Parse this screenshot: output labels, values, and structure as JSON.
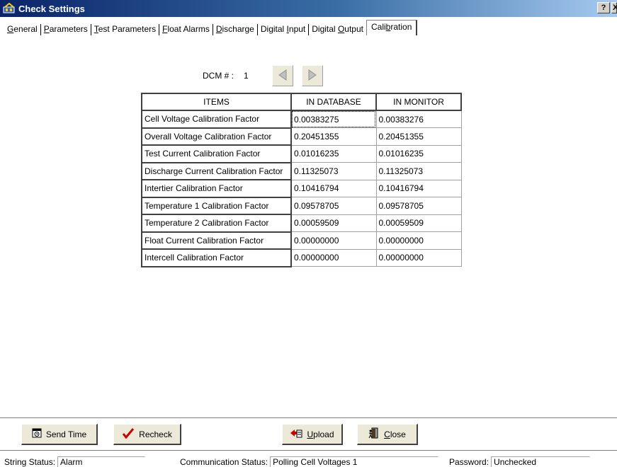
{
  "window": {
    "title": "Check Settings",
    "help_button": "?",
    "close_button": "X"
  },
  "tabs": [
    {
      "label": "General"
    },
    {
      "label": "Parameters"
    },
    {
      "label": "Test Parameters"
    },
    {
      "label": "Float Alarms"
    },
    {
      "label": "Discharge"
    },
    {
      "label": "Digital Input"
    },
    {
      "label": "Digital Output"
    },
    {
      "label": "Calibration",
      "active": true
    }
  ],
  "dcm": {
    "label": "DCM # :",
    "value": "1"
  },
  "table": {
    "headers": [
      "ITEMS",
      "IN DATABASE",
      "IN MONITOR"
    ],
    "rows": [
      {
        "item": "Cell Voltage Calibration Factor",
        "db": "0.00383275",
        "monitor": "0.00383276"
      },
      {
        "item": "Overall Voltage Calibration Factor",
        "db": "0.20451355",
        "monitor": "0.20451355"
      },
      {
        "item": "Test Current Calibration Factor",
        "db": "0.01016235",
        "monitor": "0.01016235"
      },
      {
        "item": "Discharge Current Calibration Factor",
        "db": "0.11325073",
        "monitor": "0.11325073"
      },
      {
        "item": "Intertier Calibration Factor",
        "db": "0.10416794",
        "monitor": "0.10416794"
      },
      {
        "item": "Temperature 1 Calibration Factor",
        "db": "0.09578705",
        "monitor": "0.09578705"
      },
      {
        "item": "Temperature 2 Calibration Factor",
        "db": "0.00059509",
        "monitor": "0.00059509"
      },
      {
        "item": "Float Current Calibration Factor",
        "db": "0.00000000",
        "monitor": "0.00000000"
      },
      {
        "item": "Intercell Calibration Factor",
        "db": "0.00000000",
        "monitor": "0.00000000"
      }
    ]
  },
  "buttons": {
    "send_time": "Send Time",
    "recheck": "Recheck",
    "upload": "Upload",
    "close": "Close"
  },
  "status": {
    "string_label": "String Status:",
    "string_value": "Alarm",
    "comm_label": "Communication Status:",
    "comm_value": "Polling Cell Voltages 1",
    "password_label": "Password:",
    "password_value": "Unchecked"
  },
  "colors": {
    "titlebar_start": "#0a246a",
    "titlebar_end": "#a6caf0",
    "check_red": "#cc0000"
  },
  "icons": {
    "app": "battery-app-icon",
    "prev": "arrow-left-icon",
    "next": "arrow-right-icon",
    "send_time": "calendar-clock-icon",
    "recheck": "checkmark-icon",
    "upload": "upload-icon",
    "close": "door-exit-icon"
  }
}
